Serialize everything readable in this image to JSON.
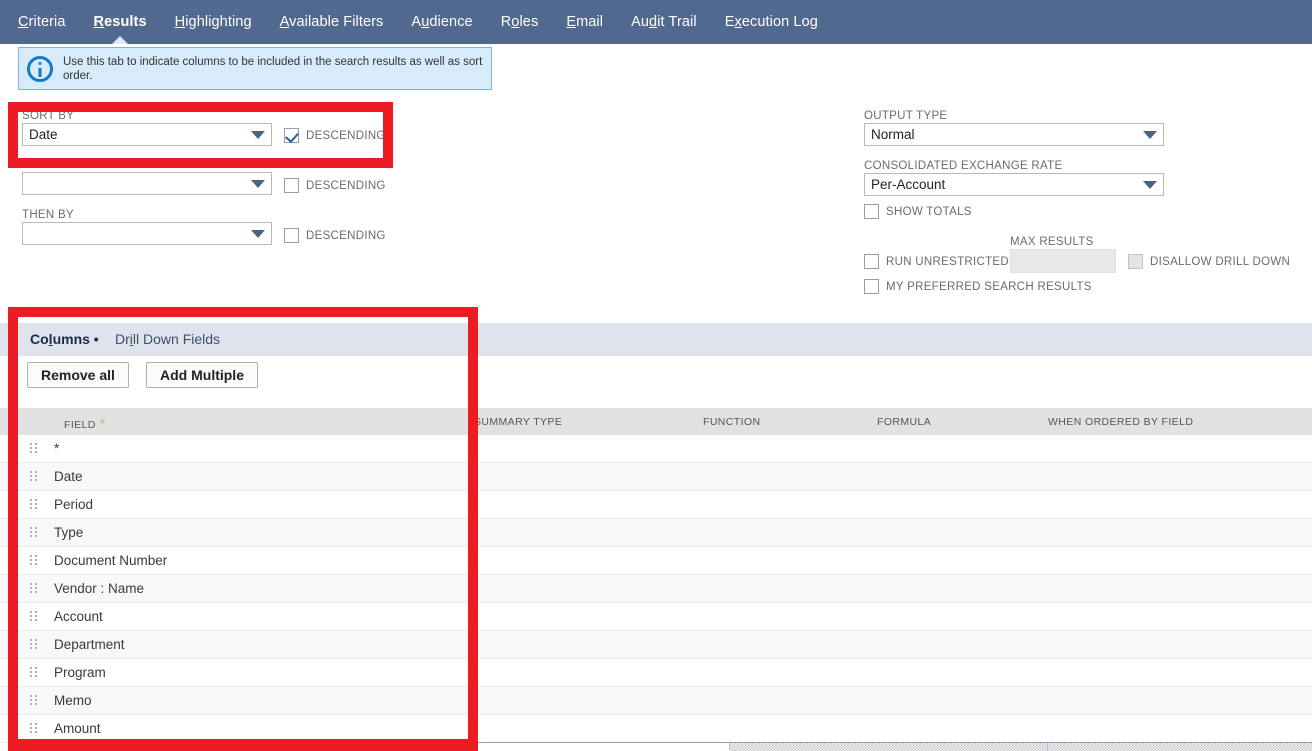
{
  "tabs": [
    {
      "label": "Criteria",
      "key": "C",
      "active": false
    },
    {
      "label": "Results",
      "key": "R",
      "active": true
    },
    {
      "label": "Highlighting",
      "key": "H",
      "active": false
    },
    {
      "label": "Available Filters",
      "key": "A",
      "active": false
    },
    {
      "label": "Audience",
      "key": "u",
      "active": false
    },
    {
      "label": "Roles",
      "key": "o",
      "active": false
    },
    {
      "label": "Email",
      "key": "E",
      "active": false
    },
    {
      "label": "Audit Trail",
      "key": "d",
      "active": false
    },
    {
      "label": "Execution Log",
      "key": "x",
      "active": false
    }
  ],
  "info_banner": {
    "icon": "info-icon",
    "text": "Use this tab to indicate columns to be included in the search results as well as sort order."
  },
  "sort_section": {
    "sort_by_label": "SORT BY",
    "sort_by_value": "Date",
    "sort_by_descending_label": "DESCENDING",
    "sort_by_descending_checked": true,
    "then_by_1_label": "THEN BY",
    "then_by_1_value": "",
    "then_by_1_descending_label": "DESCENDING",
    "then_by_1_descending_checked": false,
    "then_by_2_label": "THEN BY",
    "then_by_2_value": "",
    "then_by_2_descending_label": "DESCENDING",
    "then_by_2_descending_checked": false
  },
  "options_section": {
    "output_type_label": "OUTPUT TYPE",
    "output_type_value": "Normal",
    "consolidated_rate_label": "CONSOLIDATED EXCHANGE RATE",
    "consolidated_rate_value": "Per-Account",
    "show_totals_label": "SHOW TOTALS",
    "show_totals_checked": false,
    "max_results_label": "MAX RESULTS",
    "max_results_value": "",
    "run_unrestricted_label": "RUN UNRESTRICTED",
    "run_unrestricted_checked": false,
    "disallow_drill_down_label": "DISALLOW DRILL DOWN",
    "disallow_drill_down_checked": false,
    "my_preferred_label": "MY PREFERRED SEARCH RESULTS",
    "my_preferred_checked": false
  },
  "sub_tabs": [
    {
      "label": "Columns",
      "key": "l",
      "active": true,
      "bullet": "•"
    },
    {
      "label": "Drill Down Fields",
      "key": "i",
      "active": false
    }
  ],
  "toolbar": {
    "remove_all_label": "Remove all",
    "add_multiple_label": "Add Multiple"
  },
  "grid": {
    "columns": [
      {
        "label": "FIELD",
        "required": true
      },
      {
        "label": "SUMMARY TYPE",
        "required": false
      },
      {
        "label": "FUNCTION",
        "required": false
      },
      {
        "label": "FORMULA",
        "required": false
      },
      {
        "label": "WHEN ORDERED BY FIELD",
        "required": false
      }
    ],
    "rows": [
      {
        "field": "*"
      },
      {
        "field": "Date"
      },
      {
        "field": "Period"
      },
      {
        "field": "Type"
      },
      {
        "field": "Document Number"
      },
      {
        "field": "Vendor : Name"
      },
      {
        "field": "Account"
      },
      {
        "field": "Department"
      },
      {
        "field": "Program"
      },
      {
        "field": "Memo"
      },
      {
        "field": "Amount"
      }
    ]
  },
  "annotations": [
    {
      "name": "sort-by-highlight"
    },
    {
      "name": "columns-panel-highlight"
    }
  ],
  "colors": {
    "tabbar": "#51688f",
    "info_banner_bg": "#d6ecfb",
    "info_banner_border": "#7fb2dd",
    "substrip": "#dfe4ec",
    "grid_header": "#e2e2e2",
    "annotation_red": "#ed1c24",
    "accent_blue": "#1f5fa9",
    "required_asterisk": "#e2a33b"
  }
}
